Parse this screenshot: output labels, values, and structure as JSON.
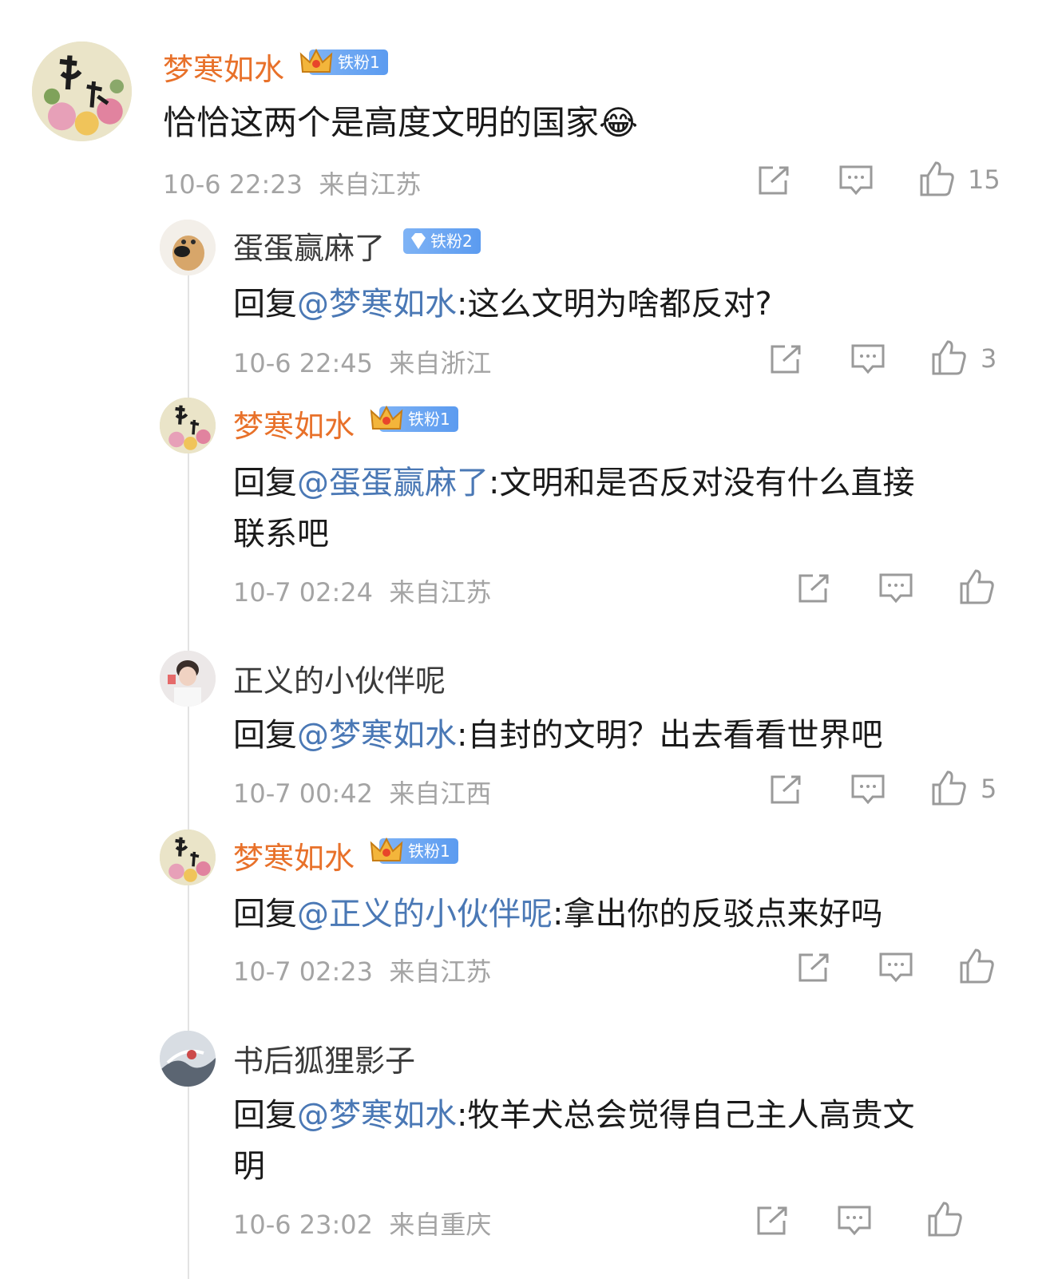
{
  "comments": [
    {
      "user": "梦寒如水",
      "badge": "铁粉1",
      "text": "恰恰这两个是高度文明的国家",
      "emoji": "😂",
      "time": "10-6 22:23",
      "location": "来自江苏",
      "likes": "15"
    }
  ],
  "replies": [
    {
      "user": "蛋蛋赢麻了",
      "badge": "铁粉2",
      "reply_prefix": "回复",
      "mention": "@梦寒如水",
      "text": ":这么文明为啥都反对?",
      "time": "10-6 22:45",
      "location": "来自浙江",
      "likes": "3"
    },
    {
      "user": "梦寒如水",
      "badge": "铁粉1",
      "reply_prefix": "回复",
      "mention": "@蛋蛋赢麻了",
      "text_line1": ":文明和是否反对没有什么直接",
      "text_line2": "联系吧",
      "time": "10-7 02:24",
      "location": "来自江苏",
      "likes": ""
    },
    {
      "user": "正义的小伙伴呢",
      "reply_prefix": "回复",
      "mention": "@梦寒如水",
      "text": ":自封的文明？出去看看世界吧",
      "time": "10-7 00:42",
      "location": "来自江西",
      "likes": "5"
    },
    {
      "user": "梦寒如水",
      "badge": "铁粉1",
      "reply_prefix": "回复",
      "mention": "@正义的小伙伴呢",
      "text": ":拿出你的反驳点来好吗",
      "time": "10-7 02:23",
      "location": "来自江苏",
      "likes": ""
    },
    {
      "user": "书后狐狸影子",
      "reply_prefix": "回复",
      "mention": "@梦寒如水",
      "text_line1": ":牧羊犬总会觉得自己主人高贵文",
      "text_line2": "明",
      "time": "10-6 23:02",
      "location": "来自重庆",
      "likes": ""
    }
  ],
  "icons": {
    "share": "share-icon",
    "comment": "comment-icon",
    "like": "thumbs-up-icon",
    "crown": "crown-icon",
    "gem": "diamond-icon"
  },
  "colors": {
    "username_highlight": "#e8712a",
    "mention": "#4a78b5",
    "badge": "#5b9bf0",
    "meta": "#a4a4a4"
  }
}
